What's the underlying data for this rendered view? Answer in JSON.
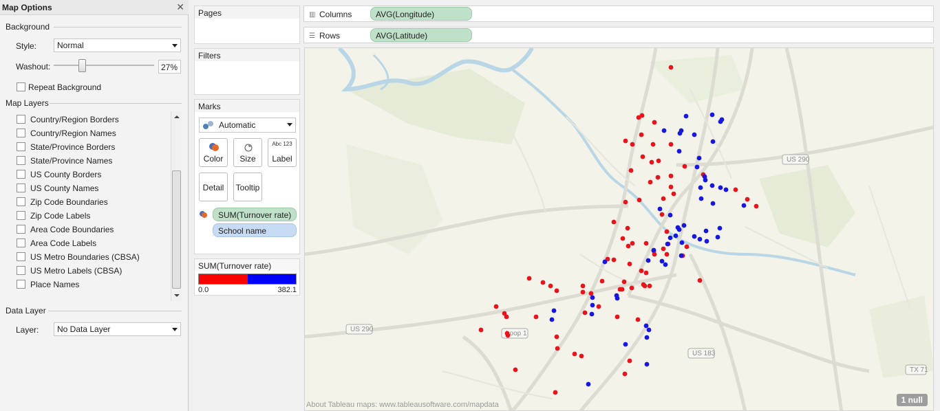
{
  "map_options": {
    "title": "Map Options",
    "close_glyph": "✕",
    "background": {
      "heading": "Background",
      "style_label": "Style:",
      "style_value": "Normal",
      "washout_label": "Washout:",
      "washout_value": "27%",
      "washout_fraction": 0.27,
      "repeat_label": "Repeat Background"
    },
    "map_layers": {
      "heading": "Map Layers",
      "items": [
        "Country/Region Borders",
        "Country/Region Names",
        "State/Province Borders",
        "State/Province Names",
        "US County Borders",
        "US County Names",
        "Zip Code Boundaries",
        "Zip Code Labels",
        "Area Code Boundaries",
        "Area Code Labels",
        "US Metro Boundaries (CBSA)",
        "US Metro Labels (CBSA)",
        "Place Names"
      ]
    },
    "data_layer": {
      "heading": "Data Layer",
      "layer_label": "Layer:",
      "layer_value": "No Data Layer"
    }
  },
  "cards": {
    "pages": "Pages",
    "filters": "Filters",
    "marks": {
      "heading": "Marks",
      "mark_type": "Automatic",
      "buttons": {
        "color": "Color",
        "size": "Size",
        "label": "Label",
        "label_icon": "Abc 123",
        "detail": "Detail",
        "tooltip": "Tooltip"
      },
      "pills": {
        "color_field": "SUM(Turnover rate)",
        "detail_field": "School name"
      }
    },
    "legend": {
      "title": "SUM(Turnover rate)",
      "min": "0.0",
      "max": "382.1",
      "low_color": "#ff0000",
      "high_color": "#0000ff"
    }
  },
  "shelves": {
    "columns_label": "Columns",
    "columns_pill": "AVG(Longitude)",
    "rows_label": "Rows",
    "rows_pill": "AVG(Latitude)"
  },
  "map": {
    "attribution": "About Tableau maps: www.tableausoftware.com/mapdata",
    "null_badge": "1 null",
    "road_labels": [
      "US 290",
      "US 290",
      "US 183",
      "TX 71",
      "Loop 1"
    ],
    "mark_colors": {
      "red": "#e8141c",
      "blue": "#1717e0"
    }
  }
}
